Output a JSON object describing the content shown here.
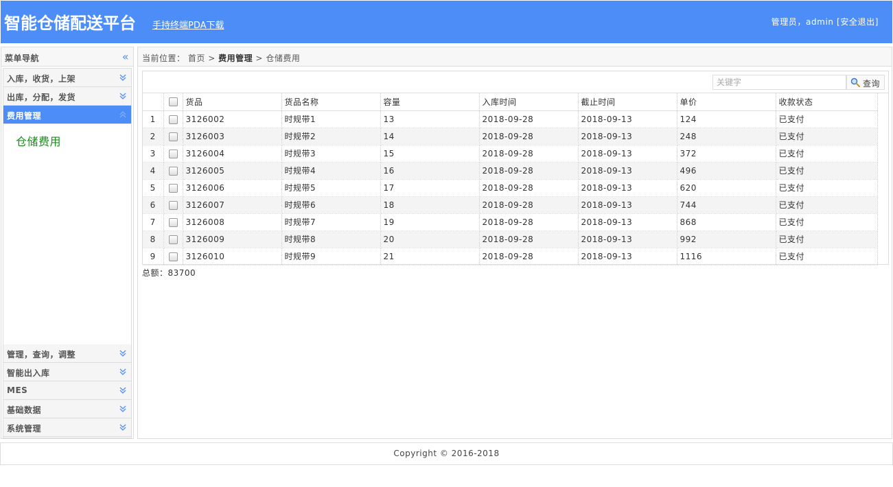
{
  "header": {
    "title": "智能仓储配送平台",
    "pda_link": "手持终端PDA下载",
    "user_text": "管理员，admin",
    "logout_label": "[安全退出]"
  },
  "sidebar": {
    "title": "菜单导航",
    "collapse_icon": "double-chevron-left-icon",
    "groups_top": [
      {
        "label": "入库，收货，上架"
      },
      {
        "label": "出库，分配，发货"
      },
      {
        "label": "费用管理"
      }
    ],
    "active_group_item": "仓储费用",
    "groups_bottom": [
      {
        "label": "管理，查询，调整"
      },
      {
        "label": "智能出入库"
      },
      {
        "label": "MES"
      },
      {
        "label": "基础数据"
      },
      {
        "label": "系统管理"
      }
    ]
  },
  "breadcrumb": {
    "prefix": "当前位置：",
    "home": "首页",
    "sep1": ">",
    "section": "费用管理",
    "sep2": ">",
    "page": "仓储费用"
  },
  "search": {
    "placeholder": "关键字",
    "button_label": "查询"
  },
  "table": {
    "columns": [
      "货品",
      "货品名称",
      "容量",
      "入库时间",
      "截止时间",
      "单价",
      "收款状态"
    ],
    "rows": [
      [
        "1",
        "3126002",
        "时规带1",
        "13",
        "2018-09-28",
        "2018-09-13",
        "124",
        "已支付"
      ],
      [
        "2",
        "3126003",
        "时规带2",
        "14",
        "2018-09-28",
        "2018-09-13",
        "248",
        "已支付"
      ],
      [
        "3",
        "3126004",
        "时规带3",
        "15",
        "2018-09-28",
        "2018-09-13",
        "372",
        "已支付"
      ],
      [
        "4",
        "3126005",
        "时规带4",
        "16",
        "2018-09-28",
        "2018-09-13",
        "496",
        "已支付"
      ],
      [
        "5",
        "3126006",
        "时规带5",
        "17",
        "2018-09-28",
        "2018-09-13",
        "620",
        "已支付"
      ],
      [
        "6",
        "3126007",
        "时规带6",
        "18",
        "2018-09-28",
        "2018-09-13",
        "744",
        "已支付"
      ],
      [
        "7",
        "3126008",
        "时规带7",
        "19",
        "2018-09-28",
        "2018-09-13",
        "868",
        "已支付"
      ],
      [
        "8",
        "3126009",
        "时规带8",
        "20",
        "2018-09-28",
        "2018-09-13",
        "992",
        "已支付"
      ],
      [
        "9",
        "3126010",
        "时规带9",
        "21",
        "2018-09-28",
        "2018-09-13",
        "1116",
        "已支付"
      ]
    ]
  },
  "total": "总额：83700",
  "footer": "Copyright © 2016-2018",
  "colors": {
    "accent": "#4d8df8",
    "link_green": "#1a8a1a"
  }
}
